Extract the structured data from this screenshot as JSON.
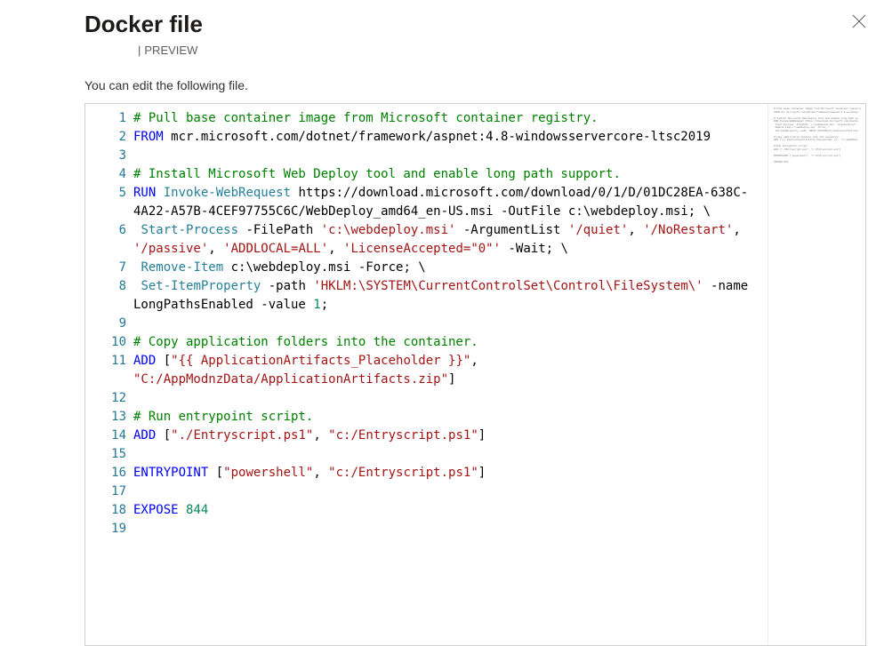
{
  "header": {
    "title": "Docker file",
    "preview_label": "PREVIEW"
  },
  "subtitle": "You can edit the following file.",
  "editor": {
    "lines": [
      {
        "n": 1,
        "tokens": [
          {
            "t": "# Pull base container image from Microsoft container registry.",
            "c": "c"
          }
        ]
      },
      {
        "n": 2,
        "tokens": [
          {
            "t": "FROM",
            "c": "kw"
          },
          {
            "t": " mcr.microsoft.com/dotnet/framework/aspnet:4.8-windowsservercore-ltsc2019",
            "c": ""
          }
        ]
      },
      {
        "n": 3,
        "tokens": []
      },
      {
        "n": 4,
        "tokens": [
          {
            "t": "# Install Microsoft Web Deploy tool and enable long path support.",
            "c": "c"
          }
        ]
      },
      {
        "n": 5,
        "tokens": [
          {
            "t": "RUN",
            "c": "kw"
          },
          {
            "t": " ",
            "c": ""
          },
          {
            "t": "Invoke-WebRequest",
            "c": "cmd"
          },
          {
            "t": " https://download.microsoft.com/download/0/1/D/01DC28EA-638C-4A22-A57B-4CEF97755C6C/WebDeploy_amd64_en-US.msi -OutFile c:\\webdeploy.msi; \\",
            "c": ""
          }
        ]
      },
      {
        "n": 6,
        "tokens": [
          {
            "t": " ",
            "c": ""
          },
          {
            "t": "Start-Process",
            "c": "cmd"
          },
          {
            "t": " -FilePath ",
            "c": ""
          },
          {
            "t": "'c:\\webdeploy.msi'",
            "c": "s"
          },
          {
            "t": " -ArgumentList ",
            "c": ""
          },
          {
            "t": "'/quiet'",
            "c": "s"
          },
          {
            "t": ", ",
            "c": ""
          },
          {
            "t": "'/NoRestart'",
            "c": "s"
          },
          {
            "t": ", ",
            "c": ""
          },
          {
            "t": "'/passive'",
            "c": "s"
          },
          {
            "t": ", ",
            "c": ""
          },
          {
            "t": "'ADDLOCAL=ALL'",
            "c": "s"
          },
          {
            "t": ", ",
            "c": ""
          },
          {
            "t": "'LicenseAccepted=\"0\"'",
            "c": "s"
          },
          {
            "t": " -Wait; \\",
            "c": ""
          }
        ]
      },
      {
        "n": 7,
        "tokens": [
          {
            "t": " ",
            "c": ""
          },
          {
            "t": "Remove-Item",
            "c": "cmd"
          },
          {
            "t": " c:\\webdeploy.msi -Force; \\",
            "c": ""
          }
        ]
      },
      {
        "n": 8,
        "tokens": [
          {
            "t": " ",
            "c": ""
          },
          {
            "t": "Set-ItemProperty",
            "c": "cmd"
          },
          {
            "t": " -path ",
            "c": ""
          },
          {
            "t": "'HKLM:\\SYSTEM\\CurrentControlSet\\Control\\FileSystem\\'",
            "c": "s"
          },
          {
            "t": " -name LongPathsEnabled -value ",
            "c": ""
          },
          {
            "t": "1",
            "c": "n"
          },
          {
            "t": ";",
            "c": ""
          }
        ]
      },
      {
        "n": 9,
        "tokens": []
      },
      {
        "n": 10,
        "tokens": [
          {
            "t": "# Copy application folders into the container.",
            "c": "c"
          }
        ]
      },
      {
        "n": 11,
        "tokens": [
          {
            "t": "ADD",
            "c": "kw"
          },
          {
            "t": " [",
            "c": ""
          },
          {
            "t": "\"{{ ApplicationArtifacts_Placeholder }}\"",
            "c": "s"
          },
          {
            "t": ", ",
            "c": ""
          },
          {
            "t": "\"C:/AppModnzData/ApplicationArtifacts.zip\"",
            "c": "s"
          },
          {
            "t": "]",
            "c": ""
          }
        ]
      },
      {
        "n": 12,
        "tokens": []
      },
      {
        "n": 13,
        "tokens": [
          {
            "t": "# Run entrypoint script.",
            "c": "c"
          }
        ]
      },
      {
        "n": 14,
        "tokens": [
          {
            "t": "ADD",
            "c": "kw"
          },
          {
            "t": " [",
            "c": ""
          },
          {
            "t": "\"./Entryscript.ps1\"",
            "c": "s"
          },
          {
            "t": ", ",
            "c": ""
          },
          {
            "t": "\"c:/Entryscript.ps1\"",
            "c": "s"
          },
          {
            "t": "]",
            "c": ""
          }
        ]
      },
      {
        "n": 15,
        "tokens": []
      },
      {
        "n": 16,
        "tokens": [
          {
            "t": "ENTRYPOINT",
            "c": "kw"
          },
          {
            "t": " [",
            "c": ""
          },
          {
            "t": "\"powershell\"",
            "c": "s"
          },
          {
            "t": ", ",
            "c": ""
          },
          {
            "t": "\"c:/Entryscript.ps1\"",
            "c": "s"
          },
          {
            "t": "]",
            "c": ""
          }
        ]
      },
      {
        "n": 17,
        "tokens": []
      },
      {
        "n": 18,
        "tokens": [
          {
            "t": "EXPOSE",
            "c": "kw"
          },
          {
            "t": " ",
            "c": ""
          },
          {
            "t": "844",
            "c": "n"
          }
        ]
      },
      {
        "n": 19,
        "tokens": []
      }
    ],
    "minimap_lines": [
      "# Pull base container image from Microsoft container registry.",
      "FROM mcr.microsoft.com/dotnet/framework/aspnet:4.8-windowss",
      "",
      "# Install Microsoft Web Deploy tool and enable long path su",
      "RUN Invoke-WebRequest https://download.microsoft.com/downlo",
      " Start-Process -FilePath 'c:\\webdeploy.msi' -ArgumentList '",
      " Remove-Item c:\\webdeploy.msi -Force; \\",
      " Set-ItemProperty -path 'HKLM:\\SYSTEM\\CurrentControlSet\\Con",
      "",
      "# Copy application folders into the container.",
      "ADD [\"{{ ApplicationArtifacts_Placeholder }}\", \"C:/AppModnz",
      "",
      "# Run entrypoint script.",
      "ADD [\"./Entryscript.ps1\", \"c:/Entryscript.ps1\"]",
      "",
      "ENTRYPOINT [\"powershell\", \"c:/Entryscript.ps1\"]",
      "",
      "EXPOSE 844",
      ""
    ]
  }
}
